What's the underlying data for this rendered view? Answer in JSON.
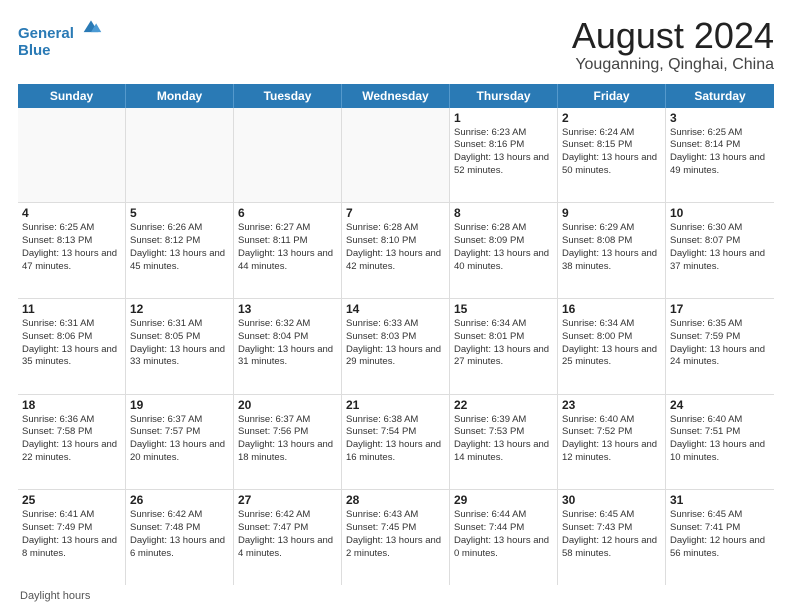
{
  "header": {
    "logo_line1": "General",
    "logo_line2": "Blue",
    "main_title": "August 2024",
    "subtitle": "Youganning, Qinghai, China"
  },
  "days_of_week": [
    "Sunday",
    "Monday",
    "Tuesday",
    "Wednesday",
    "Thursday",
    "Friday",
    "Saturday"
  ],
  "footer": {
    "daylight_label": "Daylight hours"
  },
  "weeks": [
    [
      {
        "day": "",
        "sunrise": "",
        "sunset": "",
        "daylight": "",
        "empty": true
      },
      {
        "day": "",
        "sunrise": "",
        "sunset": "",
        "daylight": "",
        "empty": true
      },
      {
        "day": "",
        "sunrise": "",
        "sunset": "",
        "daylight": "",
        "empty": true
      },
      {
        "day": "",
        "sunrise": "",
        "sunset": "",
        "daylight": "",
        "empty": true
      },
      {
        "day": "1",
        "sunrise": "Sunrise: 6:23 AM",
        "sunset": "Sunset: 8:16 PM",
        "daylight": "Daylight: 13 hours and 52 minutes."
      },
      {
        "day": "2",
        "sunrise": "Sunrise: 6:24 AM",
        "sunset": "Sunset: 8:15 PM",
        "daylight": "Daylight: 13 hours and 50 minutes."
      },
      {
        "day": "3",
        "sunrise": "Sunrise: 6:25 AM",
        "sunset": "Sunset: 8:14 PM",
        "daylight": "Daylight: 13 hours and 49 minutes."
      }
    ],
    [
      {
        "day": "4",
        "sunrise": "Sunrise: 6:25 AM",
        "sunset": "Sunset: 8:13 PM",
        "daylight": "Daylight: 13 hours and 47 minutes."
      },
      {
        "day": "5",
        "sunrise": "Sunrise: 6:26 AM",
        "sunset": "Sunset: 8:12 PM",
        "daylight": "Daylight: 13 hours and 45 minutes."
      },
      {
        "day": "6",
        "sunrise": "Sunrise: 6:27 AM",
        "sunset": "Sunset: 8:11 PM",
        "daylight": "Daylight: 13 hours and 44 minutes."
      },
      {
        "day": "7",
        "sunrise": "Sunrise: 6:28 AM",
        "sunset": "Sunset: 8:10 PM",
        "daylight": "Daylight: 13 hours and 42 minutes."
      },
      {
        "day": "8",
        "sunrise": "Sunrise: 6:28 AM",
        "sunset": "Sunset: 8:09 PM",
        "daylight": "Daylight: 13 hours and 40 minutes."
      },
      {
        "day": "9",
        "sunrise": "Sunrise: 6:29 AM",
        "sunset": "Sunset: 8:08 PM",
        "daylight": "Daylight: 13 hours and 38 minutes."
      },
      {
        "day": "10",
        "sunrise": "Sunrise: 6:30 AM",
        "sunset": "Sunset: 8:07 PM",
        "daylight": "Daylight: 13 hours and 37 minutes."
      }
    ],
    [
      {
        "day": "11",
        "sunrise": "Sunrise: 6:31 AM",
        "sunset": "Sunset: 8:06 PM",
        "daylight": "Daylight: 13 hours and 35 minutes."
      },
      {
        "day": "12",
        "sunrise": "Sunrise: 6:31 AM",
        "sunset": "Sunset: 8:05 PM",
        "daylight": "Daylight: 13 hours and 33 minutes."
      },
      {
        "day": "13",
        "sunrise": "Sunrise: 6:32 AM",
        "sunset": "Sunset: 8:04 PM",
        "daylight": "Daylight: 13 hours and 31 minutes."
      },
      {
        "day": "14",
        "sunrise": "Sunrise: 6:33 AM",
        "sunset": "Sunset: 8:03 PM",
        "daylight": "Daylight: 13 hours and 29 minutes."
      },
      {
        "day": "15",
        "sunrise": "Sunrise: 6:34 AM",
        "sunset": "Sunset: 8:01 PM",
        "daylight": "Daylight: 13 hours and 27 minutes."
      },
      {
        "day": "16",
        "sunrise": "Sunrise: 6:34 AM",
        "sunset": "Sunset: 8:00 PM",
        "daylight": "Daylight: 13 hours and 25 minutes."
      },
      {
        "day": "17",
        "sunrise": "Sunrise: 6:35 AM",
        "sunset": "Sunset: 7:59 PM",
        "daylight": "Daylight: 13 hours and 24 minutes."
      }
    ],
    [
      {
        "day": "18",
        "sunrise": "Sunrise: 6:36 AM",
        "sunset": "Sunset: 7:58 PM",
        "daylight": "Daylight: 13 hours and 22 minutes."
      },
      {
        "day": "19",
        "sunrise": "Sunrise: 6:37 AM",
        "sunset": "Sunset: 7:57 PM",
        "daylight": "Daylight: 13 hours and 20 minutes."
      },
      {
        "day": "20",
        "sunrise": "Sunrise: 6:37 AM",
        "sunset": "Sunset: 7:56 PM",
        "daylight": "Daylight: 13 hours and 18 minutes."
      },
      {
        "day": "21",
        "sunrise": "Sunrise: 6:38 AM",
        "sunset": "Sunset: 7:54 PM",
        "daylight": "Daylight: 13 hours and 16 minutes."
      },
      {
        "day": "22",
        "sunrise": "Sunrise: 6:39 AM",
        "sunset": "Sunset: 7:53 PM",
        "daylight": "Daylight: 13 hours and 14 minutes."
      },
      {
        "day": "23",
        "sunrise": "Sunrise: 6:40 AM",
        "sunset": "Sunset: 7:52 PM",
        "daylight": "Daylight: 13 hours and 12 minutes."
      },
      {
        "day": "24",
        "sunrise": "Sunrise: 6:40 AM",
        "sunset": "Sunset: 7:51 PM",
        "daylight": "Daylight: 13 hours and 10 minutes."
      }
    ],
    [
      {
        "day": "25",
        "sunrise": "Sunrise: 6:41 AM",
        "sunset": "Sunset: 7:49 PM",
        "daylight": "Daylight: 13 hours and 8 minutes."
      },
      {
        "day": "26",
        "sunrise": "Sunrise: 6:42 AM",
        "sunset": "Sunset: 7:48 PM",
        "daylight": "Daylight: 13 hours and 6 minutes."
      },
      {
        "day": "27",
        "sunrise": "Sunrise: 6:42 AM",
        "sunset": "Sunset: 7:47 PM",
        "daylight": "Daylight: 13 hours and 4 minutes."
      },
      {
        "day": "28",
        "sunrise": "Sunrise: 6:43 AM",
        "sunset": "Sunset: 7:45 PM",
        "daylight": "Daylight: 13 hours and 2 minutes."
      },
      {
        "day": "29",
        "sunrise": "Sunrise: 6:44 AM",
        "sunset": "Sunset: 7:44 PM",
        "daylight": "Daylight: 13 hours and 0 minutes."
      },
      {
        "day": "30",
        "sunrise": "Sunrise: 6:45 AM",
        "sunset": "Sunset: 7:43 PM",
        "daylight": "Daylight: 12 hours and 58 minutes."
      },
      {
        "day": "31",
        "sunrise": "Sunrise: 6:45 AM",
        "sunset": "Sunset: 7:41 PM",
        "daylight": "Daylight: 12 hours and 56 minutes."
      }
    ]
  ]
}
